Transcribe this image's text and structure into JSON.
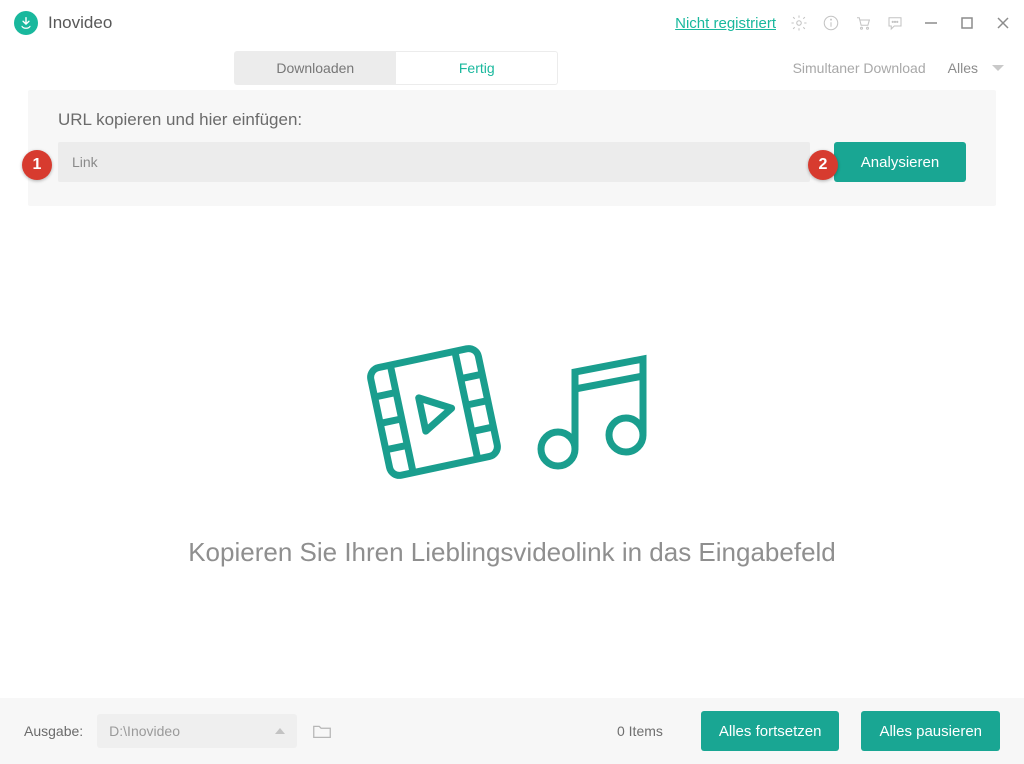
{
  "titlebar": {
    "app_name": "Inovideo",
    "not_registered": "Nicht registriert"
  },
  "tabs": {
    "download": "Downloaden",
    "finished": "Fertig"
  },
  "simul": {
    "label": "Simultaner Download",
    "value": "Alles"
  },
  "url_panel": {
    "instruction": "URL kopieren und hier einfügen:",
    "placeholder": "Link",
    "analyze": "Analysieren"
  },
  "callouts": {
    "one": "1",
    "two": "2"
  },
  "empty": {
    "message": "Kopieren Sie Ihren Lieblingsvideolink in das Eingabefeld"
  },
  "bottom": {
    "output_label": "Ausgabe:",
    "output_path": "D:\\Inovideo",
    "items_count": "0 Items",
    "resume_all": "Alles fortsetzen",
    "pause_all": "Alles pausieren"
  },
  "icons": {
    "settings": "settings",
    "info": "info",
    "cart": "cart",
    "feedback": "feedback"
  }
}
